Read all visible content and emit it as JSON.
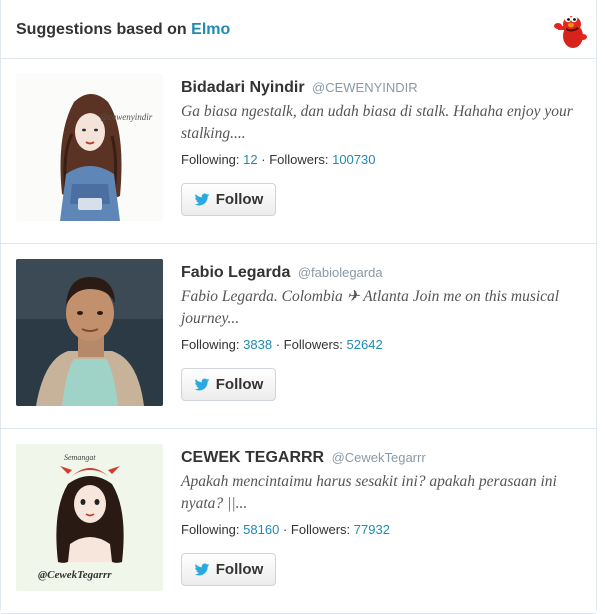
{
  "header": {
    "title_prefix": "Suggestions based on",
    "title_highlight": "Elmo",
    "avatar_icon": "elmo-avatar"
  },
  "suggestions": [
    {
      "name": "Bidadari Nyindir",
      "handle": "@CEWENYINDIR",
      "bio": "Ga biasa ngestalk, dan udah biasa di stalk. Hahaha enjoy your stalking....",
      "following_label": "Following:",
      "following": "12",
      "followers_label": "Followers:",
      "followers": "100730",
      "follow_label": "Follow",
      "avatar_text": "@cewenyindir"
    },
    {
      "name": "Fabio Legarda",
      "handle": "@fabiolegarda",
      "bio": "Fabio Legarda. Colombia ✈ Atlanta Join me on this musical journey...",
      "following_label": "Following:",
      "following": "3838",
      "followers_label": "Followers:",
      "followers": "52642",
      "follow_label": "Follow"
    },
    {
      "name": "CEWEK TEGARRR",
      "handle": "@CewekTegarrr",
      "bio": "Apakah mencintaimu harus sesakit ini? apakah perasaan ini nyata? ||...",
      "following_label": "Following:",
      "following": "58160",
      "followers_label": "Followers:",
      "followers": "77932",
      "follow_label": "Follow",
      "avatar_text": "@CewekTegarrr",
      "avatar_text_top": "Semangat"
    }
  ],
  "colors": {
    "link": "#1f8ab3",
    "twitter_bird": "#2aa9e0",
    "border": "#e1e8ed"
  }
}
